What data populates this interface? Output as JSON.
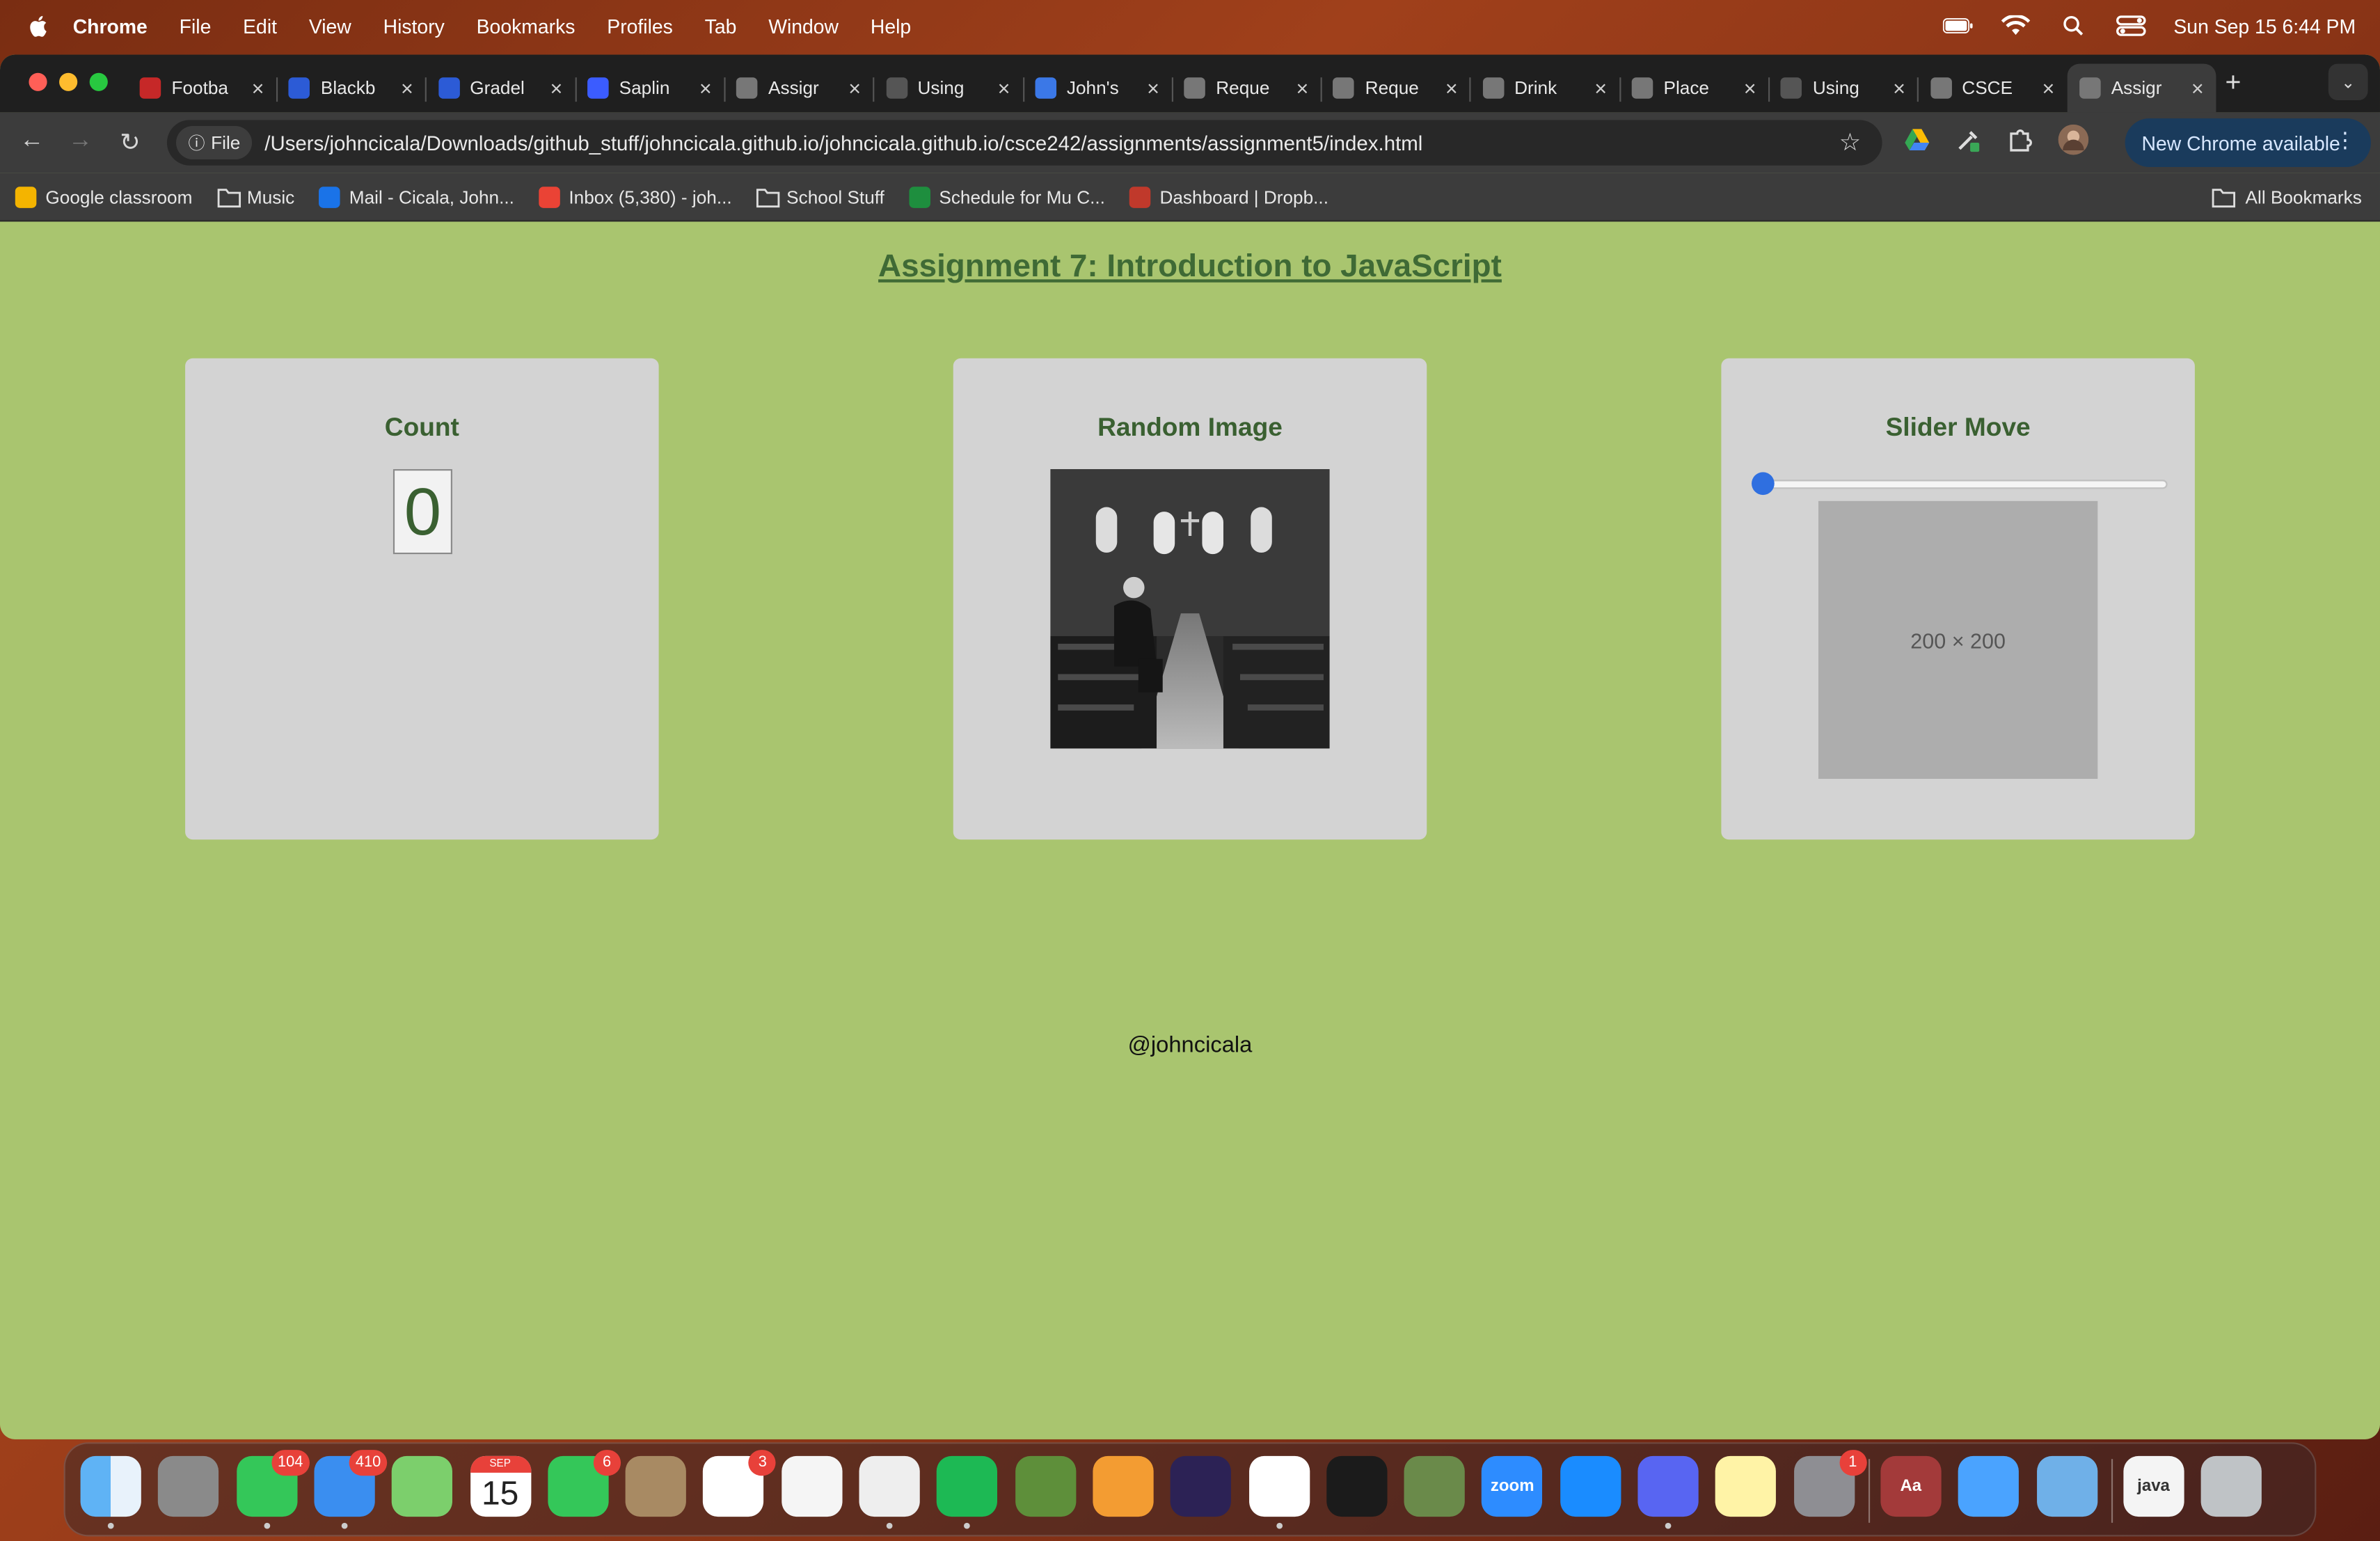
{
  "menubar": {
    "app": "Chrome",
    "items": [
      "File",
      "Edit",
      "View",
      "History",
      "Bookmarks",
      "Profiles",
      "Tab",
      "Window",
      "Help"
    ],
    "clock": "Sun Sep 15  6:44 PM"
  },
  "tabs": [
    {
      "label": "Footba",
      "icon": "b-letter-icon",
      "color": "#c62828"
    },
    {
      "label": "Blackb",
      "icon": "blackboard-icon",
      "color": "#2c5bd6"
    },
    {
      "label": "Gradel",
      "icon": "gradescope-icon",
      "color": "#2c5bd6"
    },
    {
      "label": "Saplin",
      "icon": "sapling-icon",
      "color": "#3b5cff"
    },
    {
      "label": "Assigr",
      "icon": "globe-icon",
      "color": "#777777"
    },
    {
      "label": "Using",
      "icon": "medium-icon",
      "color": "#555555"
    },
    {
      "label": "John's",
      "icon": "play-icon",
      "color": "#3b78e7"
    },
    {
      "label": "Reque",
      "icon": "openai-icon",
      "color": "#777777"
    },
    {
      "label": "Reque",
      "icon": "openai-icon",
      "color": "#777777"
    },
    {
      "label": "Drink",
      "icon": "globe-icon",
      "color": "#777777"
    },
    {
      "label": "Place",
      "icon": "placeholder-icon",
      "color": "#777777"
    },
    {
      "label": "Using",
      "icon": "medium-icon",
      "color": "#555555"
    },
    {
      "label": "CSCE",
      "icon": "globe-icon",
      "color": "#777777"
    },
    {
      "label": "Assigr",
      "icon": "globe-icon",
      "color": "#777777"
    }
  ],
  "toolbar": {
    "chip_label": "File",
    "url": "/Users/johncicala/Downloads/github_stuff/johncicala.github.io/johncicala.github.io/csce242/assignments/assignment5/index.html",
    "update_label": "New Chrome available"
  },
  "bookmarks": [
    {
      "label": "Google classroom",
      "icon": "classroom-icon"
    },
    {
      "label": "Music",
      "icon": "folder-icon"
    },
    {
      "label": "Mail - Cicala, John...",
      "icon": "outlook-icon"
    },
    {
      "label": "Inbox (5,380) - joh...",
      "icon": "gmail-icon"
    },
    {
      "label": "School Stuff",
      "icon": "folder-icon"
    },
    {
      "label": "Schedule for Mu C...",
      "icon": "excel-icon"
    },
    {
      "label": "Dashboard | Dropb...",
      "icon": "dropbox-icon"
    }
  ],
  "all_bookmarks": "All Bookmarks",
  "page": {
    "title": "Assignment 7: Introduction to JavaScript",
    "count": {
      "heading": "Count",
      "value": "0"
    },
    "random": {
      "heading": "Random Image"
    },
    "slider": {
      "heading": "Slider Move",
      "value": 0,
      "placeholder": "200 × 200"
    },
    "footer": "@johncicala"
  },
  "dock": [
    {
      "name": "finder-icon"
    },
    {
      "name": "launchpad-icon"
    },
    {
      "name": "messages-icon",
      "badge": "104"
    },
    {
      "name": "mail-icon",
      "badge": "410"
    },
    {
      "name": "maps-icon"
    },
    {
      "name": "calendar-icon",
      "month": "SEP",
      "day": "15"
    },
    {
      "name": "facetime-icon",
      "badge": "6"
    },
    {
      "name": "contacts-icon"
    },
    {
      "name": "reminders-icon",
      "badge": "3"
    },
    {
      "name": "photos-icon"
    },
    {
      "name": "chrome-icon"
    },
    {
      "name": "spotify-icon"
    },
    {
      "name": "game-icon"
    },
    {
      "name": "pages-icon"
    },
    {
      "name": "eclipse-icon"
    },
    {
      "name": "vscode-icon"
    },
    {
      "name": "terminal-icon"
    },
    {
      "name": "chess-icon"
    },
    {
      "name": "zoom-icon",
      "label": "zoom"
    },
    {
      "name": "app-store-icon"
    },
    {
      "name": "discord-icon"
    },
    {
      "name": "notes-icon"
    },
    {
      "name": "settings-icon",
      "badge": "1"
    },
    {
      "name": "dictionary-icon",
      "label": "Aa"
    },
    {
      "name": "weather-icon"
    },
    {
      "name": "network-globe-icon"
    },
    {
      "name": "java-file-icon",
      "label": "java"
    },
    {
      "name": "trash-icon"
    }
  ]
}
